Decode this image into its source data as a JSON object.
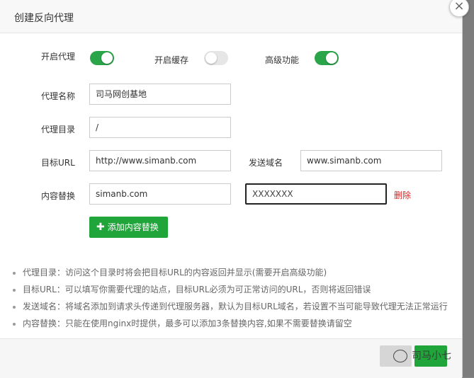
{
  "dialog": {
    "title": "创建反向代理",
    "close_glyph": "×"
  },
  "toggles": {
    "enable_proxy": {
      "label": "开启代理",
      "on": true
    },
    "enable_cache": {
      "label": "开启缓存",
      "on": false
    },
    "advanced": {
      "label": "高级功能",
      "on": true
    }
  },
  "form": {
    "proxy_name": {
      "label": "代理名称",
      "value": "司马网创基地"
    },
    "proxy_dir": {
      "label": "代理目录",
      "value": "/"
    },
    "target_url": {
      "label": "目标URL",
      "value": "http://www.simanb.com"
    },
    "send_domain": {
      "label": "发送域名",
      "value": "www.simanb.com"
    },
    "content_replace": {
      "label": "内容替换",
      "from_value": "simanb.com",
      "to_value": "XXXXXXX",
      "delete_label": "删除"
    },
    "add_replace_button": "添加内容替换"
  },
  "notes": [
    "代理目录：访问这个目录时将会把目标URL的内容返回并显示(需要开启高级功能)",
    "目标URL：可以填写你需要代理的站点，目标URL必须为可正常访问的URL，否则将返回错误",
    "发送域名：将域名添加到请求头传递到代理服务器，默认为目标URL域名，若设置不当可能导致代理无法正常运行",
    "内容替换：只能在使用nginx时提供，最多可以添加3条替换内容,如果不需要替换请留空"
  ],
  "footer": {
    "watermark": "司马小七"
  },
  "colors": {
    "accent": "#20a53a",
    "danger": "#e02020"
  }
}
